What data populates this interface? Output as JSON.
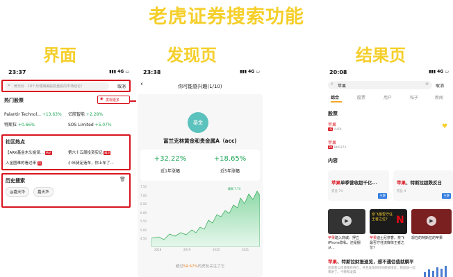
{
  "main_title": "老虎证券搜索功能",
  "sections": {
    "ui": "界面",
    "discover": "发现页",
    "result": "结果页"
  },
  "p1": {
    "time": "23:37",
    "net": "4G",
    "search_placeholder": "黄光标 · 18个月便期美股复盘看的市场结论！",
    "cancel": "取消",
    "hot_title": "热门股票",
    "discover_more": "发现更多",
    "stocks": [
      {
        "name": "Palantir Technol...",
        "chg": "+13.63%"
      },
      {
        "name": "亿航智能",
        "chg": "+2.28%"
      },
      {
        "name": "特斯拉",
        "chg": "+0.66%"
      },
      {
        "name": "SOS Limited",
        "chg": "+5.07%"
      }
    ],
    "community_title": "社区热点",
    "topics": [
      {
        "text": "【ARK基金木头姐误...",
        "tag": "热帖"
      },
      {
        "text": "第六十五周投资实记",
        "tag": "精华"
      },
      {
        "text": "入金图难的看过来",
        "tag": "问"
      },
      {
        "text": "小米骑定造车，你上车了...",
        "tag": ""
      }
    ],
    "history_title": "历史搜索",
    "history": [
      "@嘉天华",
      "嘉天华"
    ]
  },
  "p2": {
    "time": "23:38",
    "net": "4G",
    "header": "你可能感兴趣(1/10)",
    "badge": "基金",
    "fund_name": "富兰克林黄金和贵金属A（acc)",
    "ret1": "+32.22%",
    "ret1_label": "近1年涨幅",
    "ret5": "+18.65%",
    "ret5_label": "近5年涨幅",
    "y_ticks": [
      "7.50",
      "7.00",
      "6.50",
      "6.00",
      "5.50",
      "5.00",
      "4.50"
    ],
    "x_ticks": [
      "2018",
      "2019",
      "2020",
      "2021"
    ],
    "annot": "最高 7.74",
    "footer_pre": "超过",
    "footer_pct": "59.67%",
    "footer_post": "的虎友关注了它"
  },
  "p3": {
    "time": "20:08",
    "net": "4G",
    "search_value": "苹果",
    "cancel": "取消",
    "tabs": [
      "综合",
      "股票",
      "用户",
      "帖子",
      "新闻"
    ],
    "stock_title": "股票",
    "results": [
      {
        "name": "苹果",
        "code": "AAPL"
      },
      {
        "name": "苹果",
        "code": "BK0372"
      }
    ],
    "content_title": "内容",
    "cards": [
      {
        "hl": "苹果",
        "rest": "单季营收超千亿...",
        "meta": "音丝 74",
        "badge": "主题"
      },
      {
        "hl": "苹果",
        "rest": "、特斯拉超跌反日",
        "meta": "音丝 4",
        "badge": "主题"
      }
    ],
    "thumbs": [
      {
        "hl": "苹果",
        "text": "踏入商城：押立iPhone隐私。还是掘从..."
      },
      {
        "hl": "苹果",
        "text": "迪士尼奈香。奈飞最否守住流媒体王者之位?"
      },
      {
        "hl": "",
        "text": "现在的特斯拉的苹果"
      }
    ],
    "overlay": "奈飞最否守住 王者之位?",
    "article_hl": "苹果",
    "article_rest": "、特斯拉财报速览，想不通估值就躺平",
    "article_sub": "这周客公司我都有持仓，并且发现的时间都很接近，我就放一起来讲了。今晚和凌晨"
  },
  "colors": {
    "accent": "#f5cf2a",
    "red": "#d8131e",
    "green": "#1aa654",
    "teal": "#5cc2bd"
  }
}
